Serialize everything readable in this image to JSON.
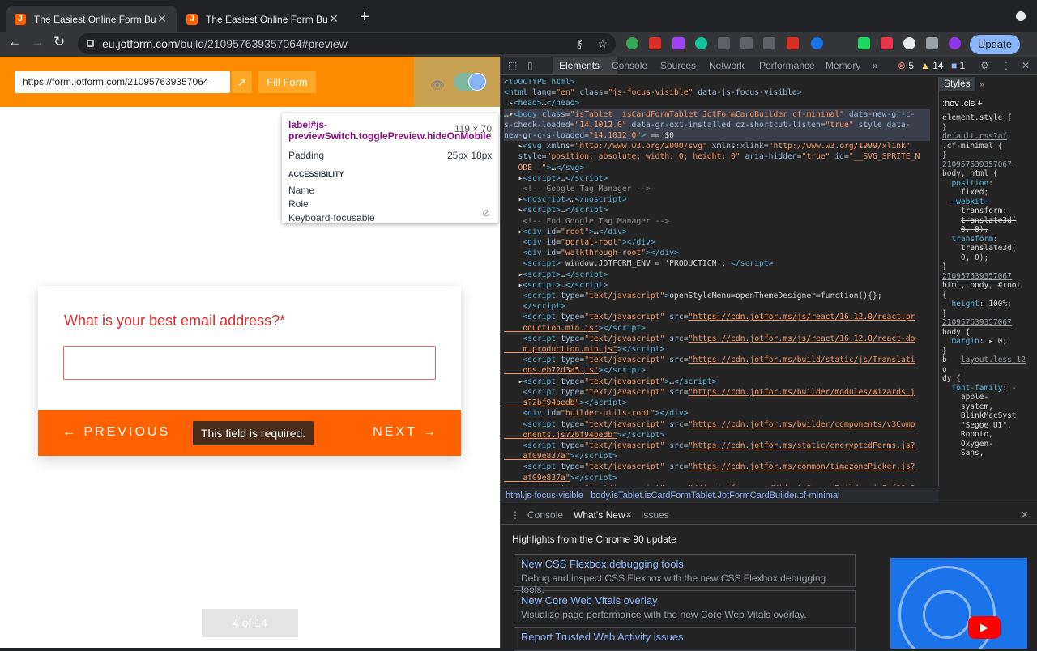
{
  "tabs": [
    {
      "title": "The Easiest Online Form Builde",
      "close": "✕"
    },
    {
      "title": "The Easiest Online Form Builde",
      "close": "✕"
    }
  ],
  "new_tab": "+",
  "address": {
    "host": "eu.jotform.com",
    "path": "/build/210957639357064#preview"
  },
  "update_label": "Update",
  "preview": {
    "form_url": "https://form.jotform.com/210957639357064",
    "fill_form_label": "Fill Form",
    "question": "What is your best email address?*",
    "prev_label": "PREVIOUS",
    "next_label": "NEXT",
    "error": "This field is required.",
    "pager": "4 of 14"
  },
  "inspect_tip": {
    "selector": "label#js-previewSwitch.togglePreview.hideOnMobile",
    "size": "119 × 70",
    "padding_label": "Padding",
    "padding_value": "25px 18px",
    "accessibility": "ACCESSIBILITY",
    "name": "Name",
    "role": "Role",
    "keyboard": "Keyboard-focusable"
  },
  "devtools": {
    "tabs": [
      "Elements",
      "Console",
      "Sources",
      "Network",
      "Performance",
      "Memory"
    ],
    "errors": "5",
    "warnings": "14",
    "info": "1",
    "crumbs": [
      "html.js-focus-visible",
      "body.isTablet.isCardFormTablet.JotFormCardBuilder.cf-minimal"
    ],
    "styles_tab": "Styles",
    "filter_hov": ":hov",
    "filter_cls": ".cls",
    "drawer_tabs": [
      "Console",
      "What's New",
      "Issues"
    ],
    "highlights": "Highlights from the Chrome 90 update",
    "news": [
      {
        "title": "New CSS Flexbox debugging tools",
        "desc": "Debug and inspect CSS Flexbox with the new CSS Flexbox debugging tools."
      },
      {
        "title": "New Core Web Vitals overlay",
        "desc": "Visualize page performance with the new Core Web Vitals overlay."
      },
      {
        "title": "Report Trusted Web Activity issues",
        "desc": ""
      }
    ]
  }
}
